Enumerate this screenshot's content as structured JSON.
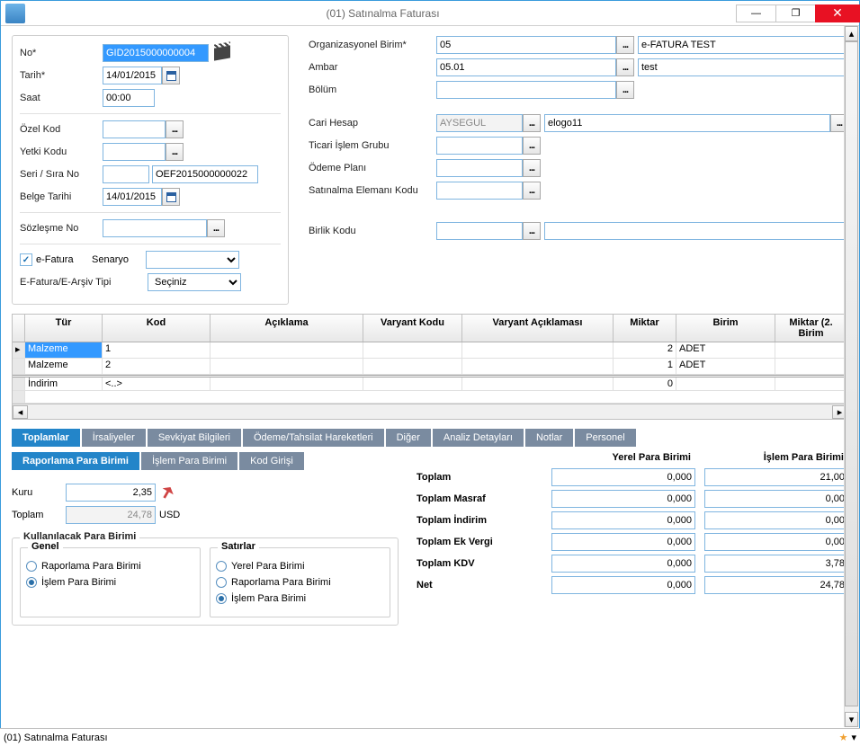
{
  "window": {
    "title": "(01) Satınalma Faturası",
    "status": "(01) Satınalma Faturası"
  },
  "left": {
    "no_lbl": "No*",
    "no_val": "GID2015000000004",
    "tarih_lbl": "Tarih*",
    "tarih_val": "14/01/2015",
    "saat_lbl": "Saat",
    "saat_val": "00:00",
    "ozel_lbl": "Özel Kod",
    "yetki_lbl": "Yetki Kodu",
    "serisira_lbl": "Seri / Sıra No",
    "serisira_val": "OEF2015000000022",
    "belge_lbl": "Belge Tarihi",
    "belge_val": "14/01/2015",
    "sozlesme_lbl": "Sözleşme No",
    "efatura_lbl": "e-Fatura",
    "senaryo_lbl": "Senaryo",
    "tip_lbl": "E-Fatura/E-Arşiv Tipi",
    "tip_val": "Seçiniz"
  },
  "right": {
    "org_lbl": "Organizasyonel Birim*",
    "org_code": "05",
    "org_desc": "e-FATURA TEST",
    "ambar_lbl": "Ambar",
    "ambar_code": "05.01",
    "ambar_desc": "test",
    "bolum_lbl": "Bölüm",
    "cari_lbl": "Cari Hesap",
    "cari_code": "AYSEGUL",
    "cari_desc": "elogo11",
    "ticari_lbl": "Ticari İşlem Grubu",
    "odeme_lbl": "Ödeme Planı",
    "satinalma_lbl": "Satınalma Elemanı Kodu",
    "birlik_lbl": "Birlik Kodu"
  },
  "grid": {
    "headers": [
      "Tür",
      "Kod",
      "Açıklama",
      "Varyant Kodu",
      "Varyant Açıklaması",
      "Miktar",
      "Birim",
      "Miktar (2. Birim"
    ],
    "rows": [
      {
        "tur": "Malzeme",
        "kod": "1",
        "acik": "",
        "vk": "",
        "va": "",
        "miktar": "2",
        "birim": "ADET"
      },
      {
        "tur": "Malzeme",
        "kod": "2",
        "acik": "",
        "vk": "",
        "va": "",
        "miktar": "1",
        "birim": "ADET"
      }
    ],
    "indirim": {
      "tur": "İndirim",
      "kod": "<..>",
      "miktar": "0"
    }
  },
  "tabs": [
    "Toplamlar",
    "İrsaliyeler",
    "Sevkiyat Bilgileri",
    "Ödeme/Tahsilat Hareketleri",
    "Diğer",
    "Analiz Detayları",
    "Notlar",
    "Personel"
  ],
  "subtabs": [
    "Raporlama Para Birimi",
    "İşlem Para Birimi",
    "Kod Girişi"
  ],
  "rpt": {
    "kuru_lbl": "Kuru",
    "kuru_val": "2,35",
    "toplam_lbl": "Toplam",
    "toplam_val": "24,78",
    "toplam_cur": "USD",
    "fs_legend": "Kullanılacak Para Birimi",
    "genel_lbl": "Genel",
    "satirlar_lbl": "Satırlar",
    "g_r1": "Raporlama Para Birimi",
    "g_r2": "İşlem Para Birimi",
    "s_r1": "Yerel Para Birimi",
    "s_r2": "Raporlama Para Birimi",
    "s_r3": "İşlem Para Birimi"
  },
  "totals": {
    "h_yerel": "Yerel Para Birimi",
    "h_islem": "İşlem Para Birimi",
    "rows": [
      {
        "l": "Toplam",
        "y": "0,000",
        "i": "21,00"
      },
      {
        "l": "Toplam Masraf",
        "y": "0,000",
        "i": "0,00"
      },
      {
        "l": "Toplam İndirim",
        "y": "0,000",
        "i": "0,00"
      },
      {
        "l": "Toplam Ek Vergi",
        "y": "0,000",
        "i": "0,00"
      },
      {
        "l": "Toplam KDV",
        "y": "0,000",
        "i": "3,78"
      },
      {
        "l": "Net",
        "y": "0,000",
        "i": "24,78"
      }
    ]
  }
}
